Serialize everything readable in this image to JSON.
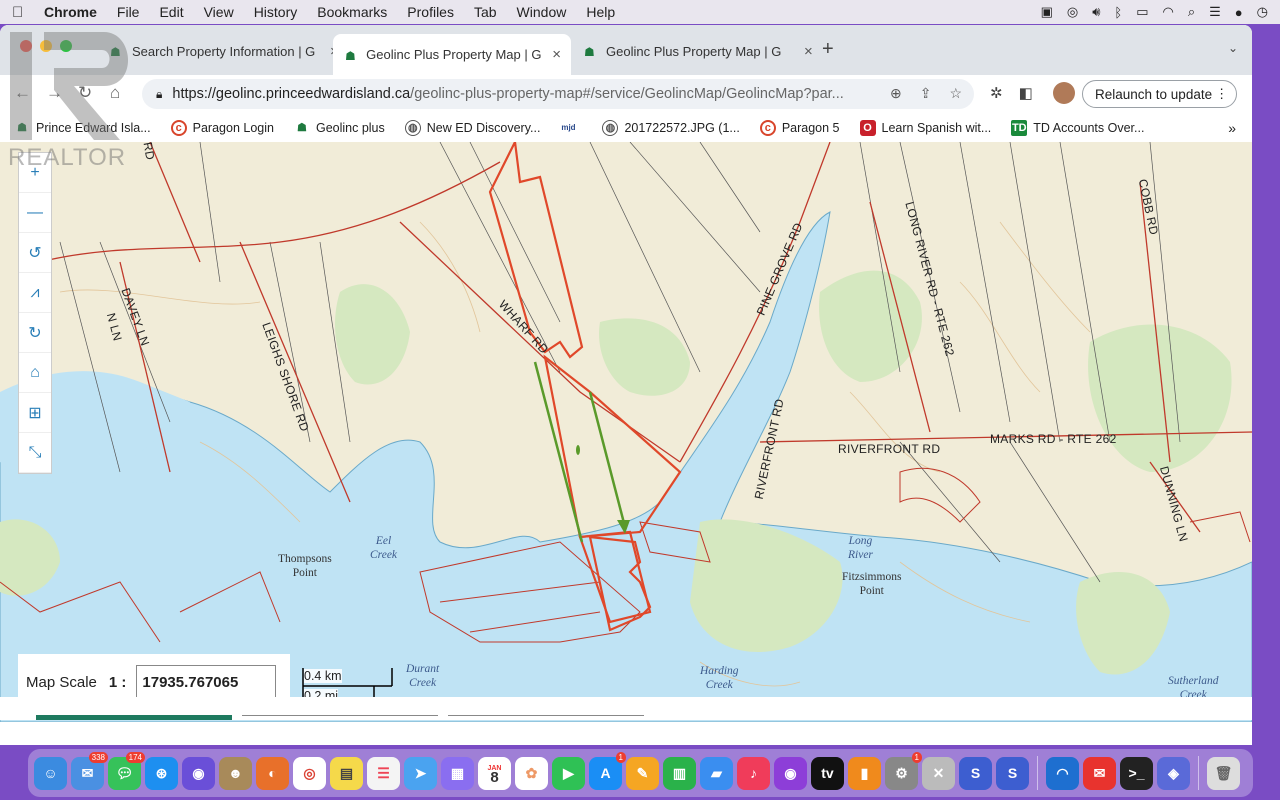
{
  "menubar": {
    "items": [
      "Chrome",
      "File",
      "Edit",
      "View",
      "History",
      "Bookmarks",
      "Profiles",
      "Tab",
      "Window",
      "Help"
    ]
  },
  "tabs": [
    {
      "title": "Search Property Information | G"
    },
    {
      "title": "Geolinc Plus Property Map | G"
    },
    {
      "title": "Geolinc Plus Property Map | G"
    }
  ],
  "toolbar": {
    "url_host": "https://geolinc.princeedwardisland.ca",
    "url_path": "/geolinc-plus-property-map#/service/GeolincMap/GeolincMap?par...",
    "relaunch_label": "Relaunch to update"
  },
  "bookmarks": [
    {
      "label": "Prince Edward Isla...",
      "icon": "geolinc-icon"
    },
    {
      "label": "Paragon Login",
      "icon": "paragon-icon"
    },
    {
      "label": "Geolinc plus",
      "icon": "geolinc-icon"
    },
    {
      "label": "New ED Discovery...",
      "icon": "globe-icon"
    },
    {
      "label": "",
      "icon": "mjd-icon"
    },
    {
      "label": "201722572.JPG (1...",
      "icon": "globe-icon"
    },
    {
      "label": "Paragon 5",
      "icon": "paragon-icon"
    },
    {
      "label": "Learn Spanish wit...",
      "icon": "learn-icon"
    },
    {
      "label": "TD Accounts Over...",
      "icon": "td-icon"
    }
  ],
  "watermark": {
    "text": "REALTOR"
  },
  "map": {
    "roads": {
      "wharf": "WHARF RD",
      "pine_grove": "PINE GROVE RD",
      "long_river": "LONG RIVER RD - RTE 262",
      "cobb": "COBB RD",
      "davey": "DAVEY LN",
      "nn": "N LN",
      "leighs_shore": "LEIGHS SHORE RD",
      "riverfront_v": "RIVERFRONT RD",
      "riverfront_h": "RIVERFRONT RD",
      "marks": "MARKS RD - RTE 262",
      "dunning": "DUNNING LN",
      "rd_top": "RD"
    },
    "water": {
      "eel": "Eel\nCreek",
      "long_river": "Long\nRiver",
      "durant": "Durant\nCreek",
      "harding": "Harding\nCreek",
      "sutherland": "Sutherland\nCreek"
    },
    "places": {
      "thompsons": "Thompsons\nPoint",
      "fitzsimmons": "Fitzsimmons\nPoint"
    },
    "scale": {
      "label": "Map Scale",
      "one": "1 :",
      "value": "17935.767065",
      "km": "0.4 km",
      "mi": "0.2 mi"
    }
  },
  "dock": {
    "mail_badge": "338",
    "messages_badge": "174",
    "calendar_month": "JAN",
    "calendar_day": "8",
    "appstore_badge": "1",
    "settings_badge": "1"
  }
}
